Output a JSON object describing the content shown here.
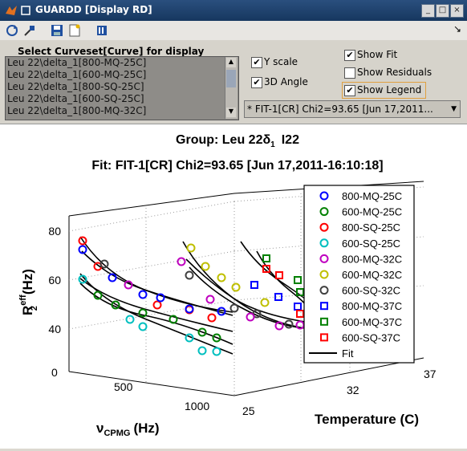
{
  "window": {
    "title": "GUARDD [Display RD]",
    "controls": [
      "_",
      "□",
      "×"
    ]
  },
  "toolbar": {
    "icons": [
      "refresh-icon",
      "pin-icon",
      "save-icon",
      "new-file-icon",
      "export-icon"
    ],
    "corner": "↘"
  },
  "panel": {
    "list_label": "Select Curveset[Curve] for display",
    "list_items": [
      "Leu 22\\delta_1[800-MQ-25C]",
      "Leu 22\\delta_1[600-MQ-25C]",
      "Leu 22\\delta_1[800-SQ-25C]",
      "Leu 22\\delta_1[600-SQ-25C]",
      "Leu 22\\delta_1[800-MQ-32C]"
    ],
    "y_scale_label": "Y scale",
    "angle_label": "3D Angle",
    "show_fit_label": "Show Fit",
    "show_residuals_label": "Show Residuals",
    "show_legend_label": "Show Legend",
    "dropdown_value": "* FIT-1[CR] Chi2=93.65 [Jun 17,2011..."
  },
  "plot": {
    "title_group": "Group: Leu 22",
    "title_group_sub": "1",
    "title_group_greek": "δ",
    "title_group_suffix": "I22",
    "title_fit": "Fit: FIT-1[CR] Chi2=93.65 [Jun 17,2011-16:10:18]",
    "legend": [
      {
        "name": "800-MQ-25C",
        "color": "#0000ff",
        "marker": "circle"
      },
      {
        "name": "600-MQ-25C",
        "color": "#008000",
        "marker": "circle"
      },
      {
        "name": "800-SQ-25C",
        "color": "#ff0000",
        "marker": "circle"
      },
      {
        "name": "600-SQ-25C",
        "color": "#00bfbf",
        "marker": "circle"
      },
      {
        "name": "800-MQ-32C",
        "color": "#bf00bf",
        "marker": "circle"
      },
      {
        "name": "600-MQ-32C",
        "color": "#bfbf00",
        "marker": "circle"
      },
      {
        "name": "600-SQ-32C",
        "color": "#404040",
        "marker": "circle"
      },
      {
        "name": "800-MQ-37C",
        "color": "#0000ff",
        "marker": "square"
      },
      {
        "name": "600-MQ-37C",
        "color": "#008000",
        "marker": "square"
      },
      {
        "name": "600-SQ-37C",
        "color": "#ff0000",
        "marker": "square"
      },
      {
        "name": "Fit",
        "color": "#000000",
        "marker": "line"
      }
    ],
    "z_ticks": [
      "80",
      "60",
      "40"
    ],
    "x_ticks": [
      "0",
      "500",
      "1000"
    ],
    "t_ticks": [
      "25",
      "32",
      "37"
    ],
    "z_label_main": "R",
    "z_label_sup": "eff",
    "z_label_sub": "2",
    "z_label_unit": "(Hz)",
    "x_label_main": "ν",
    "x_label_sub": "CPMG",
    "x_label_unit": "(Hz)",
    "t_label": "Temperature (C)"
  }
}
